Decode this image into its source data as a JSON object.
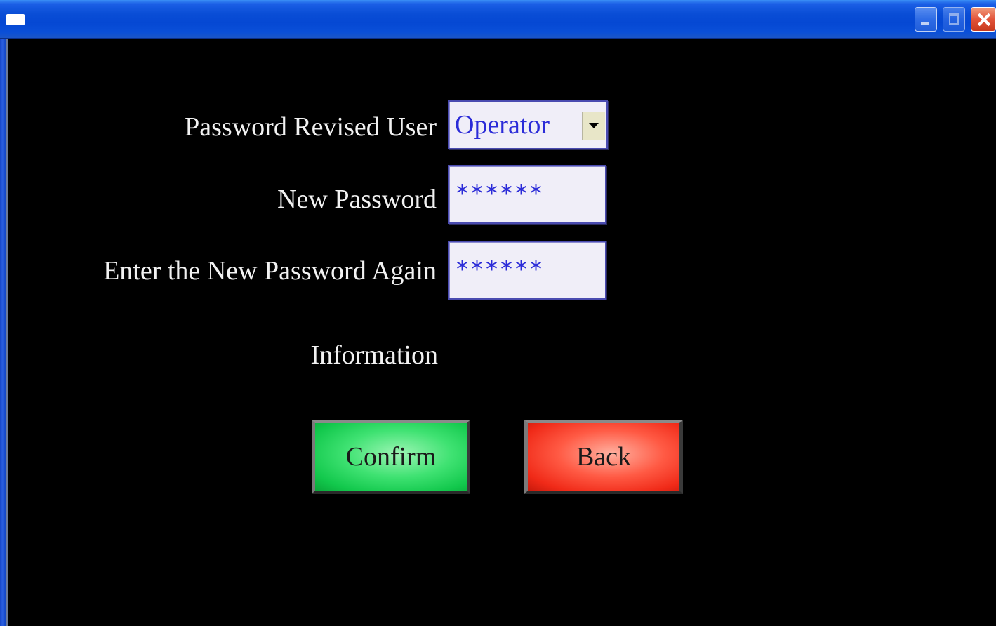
{
  "window": {
    "title": "",
    "icon": "app-icon",
    "controls": [
      "minimize-icon",
      "maximize-icon",
      "close-icon"
    ]
  },
  "form": {
    "user_label": "Password Revised User",
    "user_value": "Operator",
    "new_password_label": "New Password",
    "new_password_value": "******",
    "confirm_password_label": "Enter the New Password Again",
    "confirm_password_value": "******",
    "information_label": "Information"
  },
  "buttons": {
    "confirm_label": "Confirm",
    "back_label": "Back"
  },
  "colors": {
    "background": "#000000",
    "field_text": "#2b2bd8",
    "confirm_button": "#3fe272",
    "back_button": "#ff5a44"
  }
}
